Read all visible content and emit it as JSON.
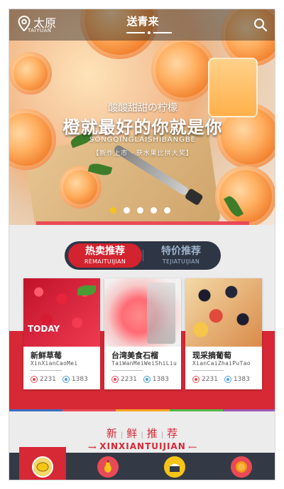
{
  "header": {
    "city": "太原",
    "city_pinyin": "TAIYUAN",
    "title": "送青来"
  },
  "banner": {
    "line1": "酸酸甜甜の柠檬",
    "line2": "橙就最好的你就是你",
    "line3": "SONGQINGLAISHIBANGBE",
    "line4": "【新作上市 · 获水果比拼大奖】",
    "slides": 5,
    "active_slide": 0
  },
  "tabs": [
    {
      "label": "热卖推荐",
      "sub": "REMAITUIJIAN",
      "active": true
    },
    {
      "label": "特价推荐",
      "sub": "TEJIATUIJIAN",
      "active": false
    }
  ],
  "products": [
    {
      "name": "新鲜草莓",
      "pinyin": "XinXianCaoMei",
      "views": "2231",
      "likes": "1383",
      "badge": "TODAY"
    },
    {
      "name": "台湾美食石榴",
      "pinyin": "TaiWanMeiWeiShiLiu",
      "views": "2231",
      "likes": "1383"
    },
    {
      "name": "现采摘葡萄",
      "pinyin": "XianCaiZhaiPuTao",
      "views": "2231",
      "likes": "1383"
    }
  ],
  "section": {
    "title_chars": [
      "新",
      "鲜",
      "推",
      "荐"
    ],
    "subtitle": "XINXIANTUIJIAN"
  },
  "bottom_nav": [
    {
      "icon": "lemon-icon",
      "active": true
    },
    {
      "icon": "pear-icon",
      "active": false
    },
    {
      "icon": "cake-icon",
      "active": false
    },
    {
      "icon": "orange-icon",
      "active": false
    }
  ],
  "colors": {
    "primary_red": "#d72836",
    "dark_nav": "#343a45",
    "tab_bg": "#2e3645"
  }
}
